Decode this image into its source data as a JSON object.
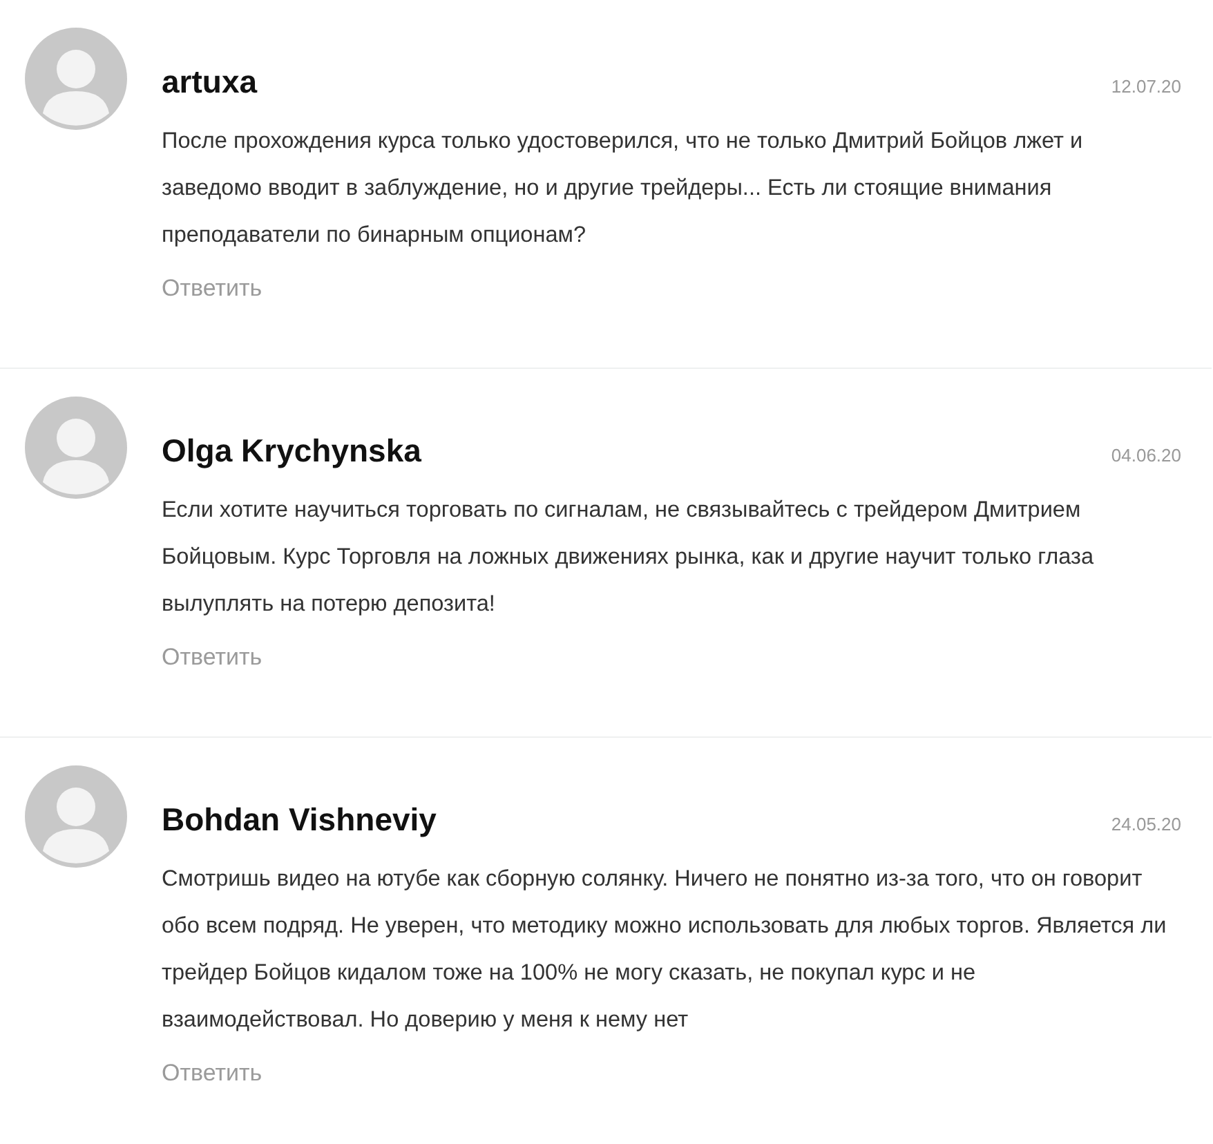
{
  "comments": [
    {
      "author": "artuxa",
      "date": "12.07.20",
      "text": "После прохождения курса только удостоверился, что не только Дмитрий Бойцов лжет и заведомо вводит в заблуждение, но и другие трейдеры... Есть ли стоящие внимания преподаватели по бинарным опционам?",
      "reply": "Ответить"
    },
    {
      "author": "Olga Krychynska",
      "date": "04.06.20",
      "text": "Если хотите научиться торговать по сигналам, не связывайтесь с трейдером Дмитрием Бойцовым. Курс Торговля на ложных движениях рынка, как и другие научит только глаза вылуплять на потерю депозита!",
      "reply": "Ответить"
    },
    {
      "author": "Bohdan Vishneviy",
      "date": "24.05.20",
      "text": "Смотришь видео на ютубе как сборную солянку. Ничего не понятно из-за того, что он говорит обо всем подряд. Не уверен, что методику можно использовать для любых торгов. Является ли трейдер Бойцов кидалом тоже на 100% не могу сказать, не покупал курс и не взаимодействовал. Но доверию у меня к нему нет",
      "reply": "Ответить"
    }
  ]
}
